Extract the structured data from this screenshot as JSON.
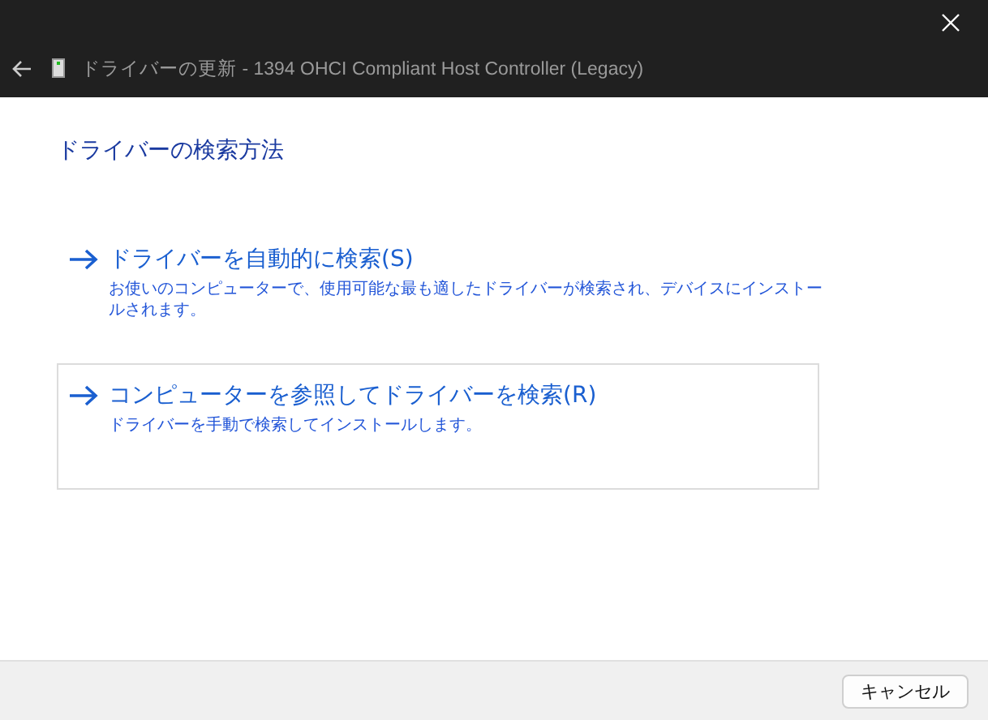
{
  "window": {
    "title": "ドライバーの更新 - 1394 OHCI Compliant Host Controller (Legacy)"
  },
  "heading": "ドライバーの検索方法",
  "options": [
    {
      "label": "ドライバーを自動的に検索(S)",
      "description": "お使いのコンピューターで、使用可能な最も適したドライバーが検索され、デバイスにインストールされます。",
      "highlighted": false
    },
    {
      "label": "コンピューターを参照してドライバーを検索(R)",
      "description": "ドライバーを手動で検索してインストールします。",
      "highlighted": true
    }
  ],
  "buttons": [
    "キャンセル"
  ]
}
